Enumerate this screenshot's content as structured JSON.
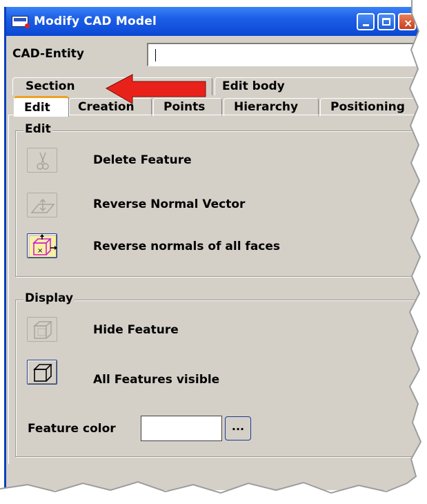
{
  "window": {
    "title": "Modify CAD Model"
  },
  "cad_entity": {
    "label": "CAD-Entity",
    "value": ""
  },
  "tabs_row1": [
    {
      "label": "Section"
    },
    {
      "label": "Edit body"
    }
  ],
  "tabs_row2": [
    {
      "label": "Edit",
      "active": true
    },
    {
      "label": "Creation"
    },
    {
      "label": "Points"
    },
    {
      "label": "Hierarchy"
    },
    {
      "label": "Positioning"
    }
  ],
  "edit_group": {
    "legend": "Edit",
    "items": [
      {
        "label": "Delete Feature",
        "icon": "scissors-icon",
        "enabled": false
      },
      {
        "label": "Reverse Normal Vector",
        "icon": "reverse-normal-icon",
        "enabled": false
      },
      {
        "label": "Reverse normals of all faces",
        "icon": "reverse-all-normals-icon",
        "enabled": true
      }
    ]
  },
  "display_group": {
    "legend": "Display",
    "items": [
      {
        "label": "Hide Feature",
        "icon": "hide-cube-icon",
        "enabled": false
      },
      {
        "label": "All Features visible",
        "icon": "cube-icon",
        "enabled": true
      }
    ],
    "feature_color": {
      "label": "Feature color",
      "value": "#ffffff",
      "button_label": "..."
    }
  },
  "colors": {
    "titlebar": "#1d5ee6",
    "window_bg": "#d4d0c8",
    "arrow": "#e8221b",
    "active_tab_accent": "#f0a020"
  }
}
